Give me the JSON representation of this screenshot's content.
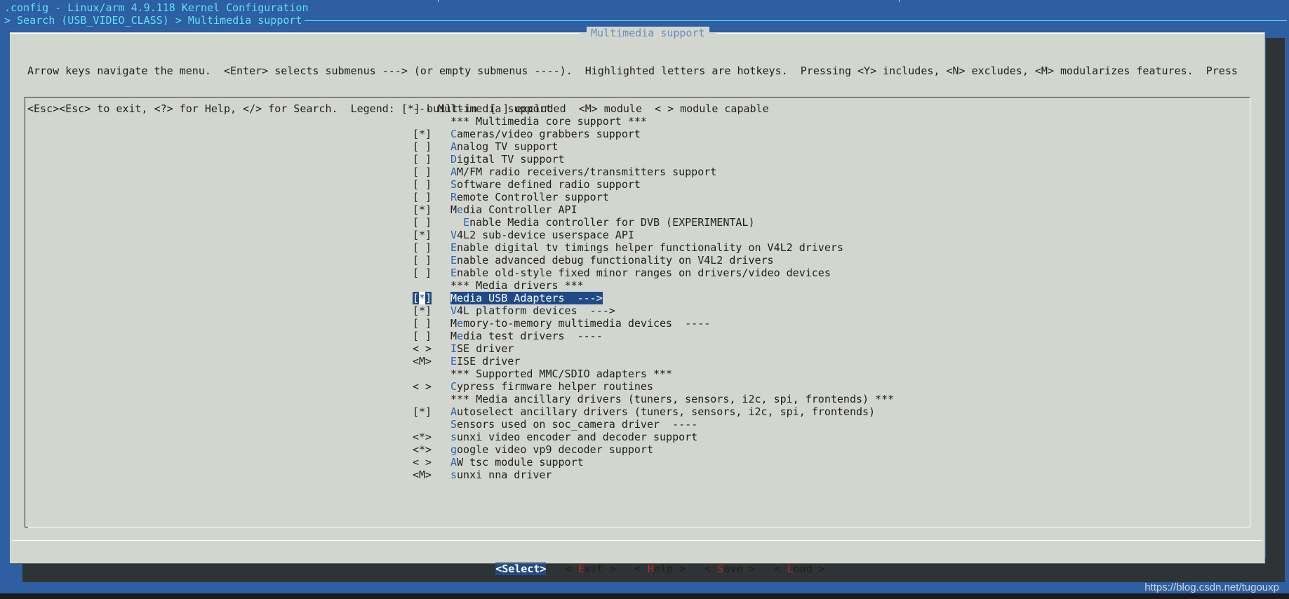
{
  "window": {
    "title": ".config - Linux/arm 4.9.118 Kernel Configuration",
    "breadcrumb": "> Search (USB_VIDEO_CLASS) > Multimedia support"
  },
  "dialog": {
    "title": "Multimedia support",
    "help_line1": "Arrow keys navigate the menu.  <Enter> selects submenus ---> (or empty submenus ----).  Highlighted letters are hotkeys.  Pressing <Y> includes, <N> excludes, <M> modularizes features.  Press",
    "help_line2": "<Esc><Esc> to exit, <?> for Help, </> for Search.  Legend: [*] built-in  [ ] excluded  <M> module  < > module capable"
  },
  "menu": {
    "items": [
      {
        "state": "---",
        "pre": "",
        "hot": "",
        "rest": "Multimedia support",
        "indent": false,
        "header": true
      },
      {
        "state": "",
        "pre": "",
        "hot": "",
        "rest": "*** Multimedia core support ***"
      },
      {
        "state": "[*]",
        "pre": "",
        "hot": "C",
        "rest": "ameras/video grabbers support"
      },
      {
        "state": "[ ]",
        "pre": "",
        "hot": "A",
        "rest": "nalog TV support"
      },
      {
        "state": "[ ]",
        "pre": "",
        "hot": "D",
        "rest": "igital TV support"
      },
      {
        "state": "[ ]",
        "pre": "",
        "hot": "A",
        "rest": "M/FM radio receivers/transmitters support"
      },
      {
        "state": "[ ]",
        "pre": "",
        "hot": "S",
        "rest": "oftware defined radio support"
      },
      {
        "state": "[ ]",
        "pre": "",
        "hot": "R",
        "rest": "emote Controller support"
      },
      {
        "state": "[*]",
        "pre": "M",
        "hot": "e",
        "rest": "dia Controller API"
      },
      {
        "state": "[ ]",
        "pre": "  ",
        "hot": "E",
        "rest": "nable Media controller for DVB (EXPERIMENTAL)"
      },
      {
        "state": "[*]",
        "pre": "",
        "hot": "V",
        "rest": "4L2 sub-device userspace API"
      },
      {
        "state": "[ ]",
        "pre": "",
        "hot": "E",
        "rest": "nable digital tv timings helper functionality on V4L2 drivers"
      },
      {
        "state": "[ ]",
        "pre": "",
        "hot": "E",
        "rest": "nable advanced debug functionality on V4L2 drivers"
      },
      {
        "state": "[ ]",
        "pre": "",
        "hot": "E",
        "rest": "nable old-style fixed minor ranges on drivers/video devices"
      },
      {
        "state": "",
        "pre": "",
        "hot": "",
        "rest": "*** Media drivers ***"
      },
      {
        "state": "[*]",
        "pre": "M",
        "hot": "e",
        "rest": "dia USB Adapters  --->",
        "selected": true
      },
      {
        "state": "[*]",
        "pre": "",
        "hot": "V",
        "rest": "4L platform devices  --->"
      },
      {
        "state": "[ ]",
        "pre": "M",
        "hot": "e",
        "rest": "mory-to-memory multimedia devices  ----"
      },
      {
        "state": "[ ]",
        "pre": "M",
        "hot": "e",
        "rest": "dia test drivers  ----"
      },
      {
        "state": "< >",
        "pre": "",
        "hot": "I",
        "rest": "SE driver"
      },
      {
        "state": "<M>",
        "pre": "",
        "hot": "E",
        "rest": "ISE driver"
      },
      {
        "state": "",
        "pre": "",
        "hot": "",
        "rest": "*** Supported MMC/SDIO adapters ***"
      },
      {
        "state": "< >",
        "pre": "",
        "hot": "C",
        "rest": "ypress firmware helper routines"
      },
      {
        "state": "",
        "pre": "",
        "hot": "",
        "rest": "*** Media ancillary drivers (tuners, sensors, i2c, spi, frontends) ***"
      },
      {
        "state": "[*]",
        "pre": "",
        "hot": "A",
        "rest": "utoselect ancillary drivers (tuners, sensors, i2c, spi, frontends)"
      },
      {
        "state": "",
        "pre": "",
        "hot": "S",
        "rest": "ensors used on soc_camera driver  ----"
      },
      {
        "state": "<*>",
        "pre": "",
        "hot": "s",
        "rest": "unxi video encoder and decoder support"
      },
      {
        "state": "<*>",
        "pre": "",
        "hot": "g",
        "rest": "oogle video vp9 decoder support"
      },
      {
        "state": "< >",
        "pre": "",
        "hot": "A",
        "rest": "W tsc module support"
      },
      {
        "state": "<M>",
        "pre": "",
        "hot": "s",
        "rest": "unxi nna driver"
      }
    ]
  },
  "buttons": {
    "select": {
      "pre": "<",
      "hot": "S",
      "rest": "elect>"
    },
    "exit": {
      "pre": "< ",
      "hot": "E",
      "rest": "xit >"
    },
    "help": {
      "pre": "< ",
      "hot": "H",
      "rest": "elp >"
    },
    "save": {
      "pre": "< ",
      "hot": "S",
      "rest": "ave >"
    },
    "load": {
      "pre": "< ",
      "hot": "L",
      "rest": "oad >"
    }
  },
  "watermark": "https://blog.csdn.net/tugouxp",
  "colors": {
    "background": "#2d5fa2",
    "dialog": "#d3d6ce",
    "selection": "#204a87",
    "title_text": "#5fe3f0",
    "hotkey_menu": "#2a62b8",
    "hotkey_button": "#c4221f"
  }
}
